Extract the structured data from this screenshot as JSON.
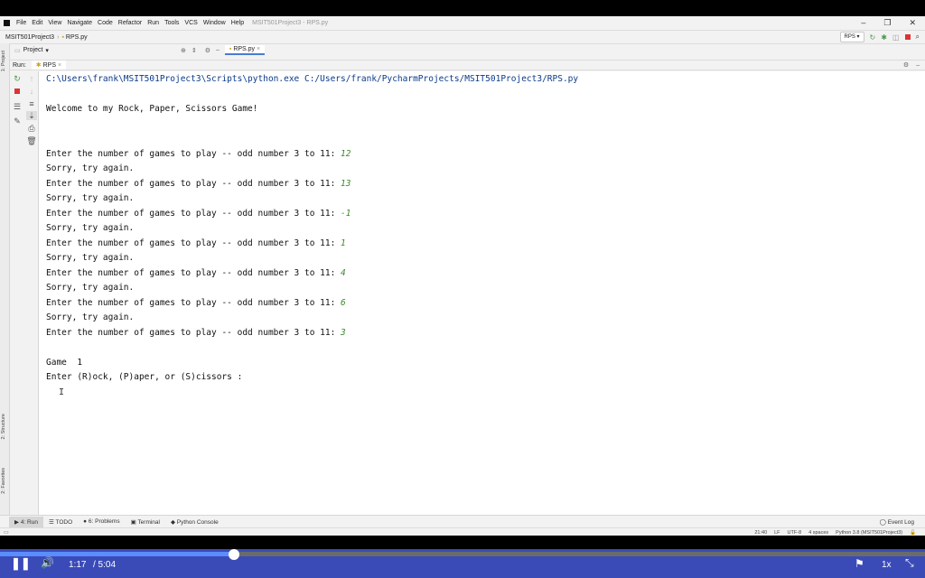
{
  "window": {
    "menu": [
      "File",
      "Edit",
      "View",
      "Navigate",
      "Code",
      "Refactor",
      "Run",
      "Tools",
      "VCS",
      "Window",
      "Help"
    ],
    "title": "MSIT501Project3 - RPS.py",
    "controls": [
      "–",
      "❐",
      "✕"
    ]
  },
  "navbar": {
    "project": "MSIT501Project3",
    "file": "RPS.py",
    "run_config": "RPS"
  },
  "toolbar": {
    "project_label": "Project",
    "editor_tab": "RPS.py"
  },
  "side_tabs": {
    "project": "1: Project",
    "structure": "2: Structure",
    "favorites": "2: Favorites"
  },
  "run": {
    "label": "Run:",
    "tab": "RPS"
  },
  "console": {
    "command": "C:\\Users\\frank\\MSIT501Project3\\Scripts\\python.exe C:/Users/frank/PycharmProjects/MSIT501Project3/RPS.py",
    "welcome": "Welcome to my Rock, Paper, Scissors Game!",
    "prompt": "Enter the number of games to play -- odd number 3 to 11: ",
    "sorry": "Sorry, try again.",
    "inputs": [
      "12",
      "13",
      "-1",
      "1",
      "4",
      "6",
      "3"
    ],
    "game": "Game  1",
    "choice_prompt": "Enter (R)ock, (P)aper, or (S)cissors :"
  },
  "bottom_tabs": [
    "4: Run",
    "TODO",
    "6: Problems",
    "Terminal",
    "Python Console"
  ],
  "event_log": "Event Log",
  "status": {
    "position": "21:40",
    "line_sep": "LF",
    "encoding": "UTF-8",
    "indent": "4 spaces",
    "interpreter": "Python 3.8 (MSIT501Project3)"
  },
  "player": {
    "current_time": "1:17",
    "duration": "/ 5:04",
    "speed": "1x",
    "progress_fraction": 0.2533
  }
}
